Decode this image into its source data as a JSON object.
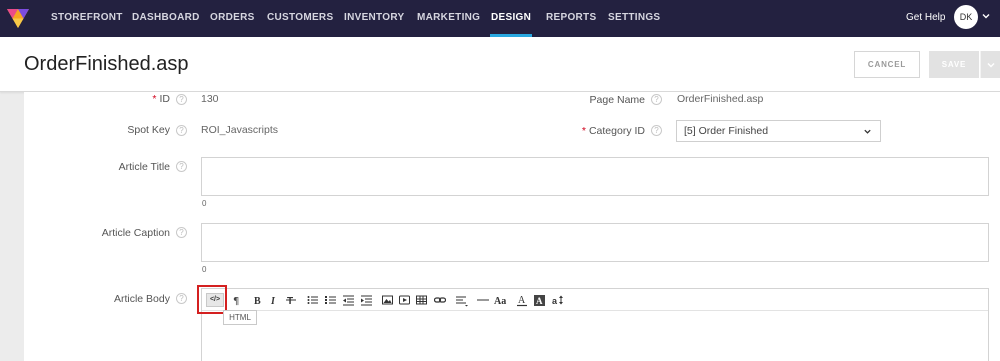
{
  "nav": {
    "items": [
      {
        "label": "STOREFRONT"
      },
      {
        "label": "DASHBOARD"
      },
      {
        "label": "ORDERS"
      },
      {
        "label": "CUSTOMERS"
      },
      {
        "label": "INVENTORY"
      },
      {
        "label": "MARKETING"
      },
      {
        "label": "DESIGN",
        "active": true
      },
      {
        "label": "REPORTS"
      },
      {
        "label": "SETTINGS"
      }
    ],
    "get_help": "Get Help",
    "avatar_initials": "DK"
  },
  "header": {
    "title": "OrderFinished.asp",
    "cancel_label": "CANCEL",
    "save_label": "SAVE"
  },
  "form": {
    "id_label": "ID",
    "id_value": "130",
    "page_name_label": "Page Name",
    "page_name_value": "OrderFinished.asp",
    "spot_key_label": "Spot Key",
    "spot_key_value": "ROI_Javascripts",
    "category_label": "Category ID",
    "category_value": "[5] Order Finished",
    "article_title_label": "Article Title",
    "article_title_count": "0",
    "article_caption_label": "Article Caption",
    "article_caption_count": "0",
    "article_body_label": "Article Body",
    "required_mark": "*",
    "help_glyph": "?"
  },
  "editor": {
    "html_button": "</>",
    "tooltip": "HTML",
    "tools": [
      "paragraph-icon",
      "bold-icon",
      "italic-icon",
      "strikethrough-icon",
      "bullet-list-icon",
      "numbered-list-icon",
      "outdent-icon",
      "indent-icon",
      "image-icon",
      "video-icon",
      "table-icon",
      "link-icon",
      "align-icon",
      "horizontal-rule-icon",
      "font-size-icon",
      "font-color-icon",
      "background-color-icon",
      "line-height-icon"
    ]
  },
  "colors": {
    "nav_bg": "#232140",
    "nav_active_underline": "#29a8e0",
    "required": "#d0021b",
    "highlight": "#d42020"
  }
}
